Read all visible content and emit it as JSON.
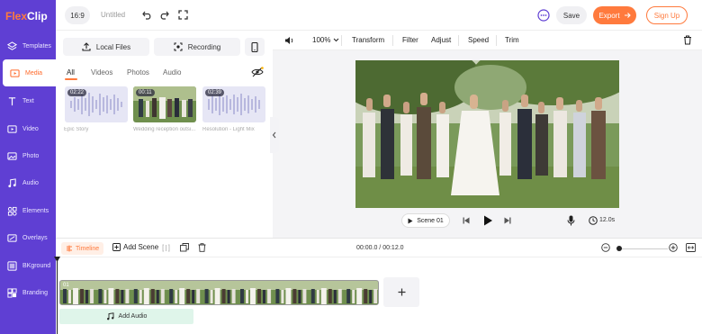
{
  "app": {
    "logo_text_a": "Flex",
    "logo_text_b": "Clip"
  },
  "sidebar": {
    "items": [
      {
        "label": "Templates",
        "icon": "layers-icon"
      },
      {
        "label": "Media",
        "icon": "folder-icon",
        "active": true
      },
      {
        "label": "Text",
        "icon": "text-icon"
      },
      {
        "label": "Video",
        "icon": "video-icon"
      },
      {
        "label": "Photo",
        "icon": "photo-icon"
      },
      {
        "label": "Audio",
        "icon": "music-icon"
      },
      {
        "label": "Elements",
        "icon": "elements-icon"
      },
      {
        "label": "Overlays",
        "icon": "overlays-icon"
      },
      {
        "label": "BKground",
        "icon": "background-icon"
      },
      {
        "label": "Branding",
        "icon": "branding-icon"
      }
    ]
  },
  "topbar": {
    "ratio": "16:9",
    "title": "Untitled",
    "save": "Save",
    "export": "Export",
    "signup": "Sign Up"
  },
  "media": {
    "local_files": "Local Files",
    "recording": "Recording",
    "tabs": [
      "All",
      "Videos",
      "Photos",
      "Audio"
    ],
    "items": [
      {
        "duration": "02:22",
        "title": "Epic Story",
        "kind": "audio"
      },
      {
        "duration": "00:11",
        "title": "Wedding reception outsi...",
        "kind": "video"
      },
      {
        "duration": "02:39",
        "title": "Resolution - Light Mix",
        "kind": "audio"
      }
    ]
  },
  "preview_toolbar": {
    "zoom": "100%",
    "tools": [
      "Transform",
      "Filter",
      "Adjust",
      "Speed",
      "Trim"
    ]
  },
  "player": {
    "scene": "Scene 01",
    "duration": "12.0s"
  },
  "timeline": {
    "label": "Timeline",
    "add_scene": "Add Scene",
    "timecode": "00:00.0 / 00:12.0",
    "clip_label": "01",
    "add_audio": "Add Audio"
  },
  "colors": {
    "brand_purple": "#5f3fd3",
    "accent_orange": "#ff7a3d"
  }
}
